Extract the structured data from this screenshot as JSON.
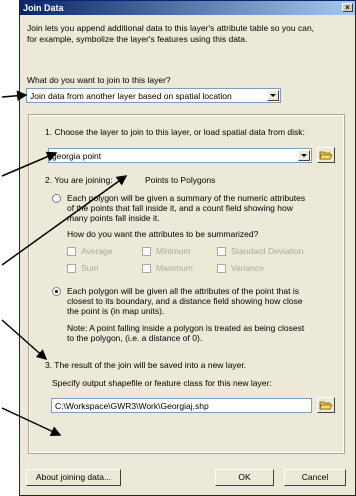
{
  "window": {
    "title": "Join Data",
    "close_glyph": "×"
  },
  "intro": {
    "line1": "Join lets you append additional data to this layer's attribute table so you can,",
    "line2": "for example, symbolize the layer's features using this data."
  },
  "join_type": {
    "question": "What do you want to join to this layer?",
    "selected": "Join data from another layer based on spatial location"
  },
  "step1": {
    "label": "1.  Choose the layer to join to this layer, or load spatial data from disk:",
    "layer": "georgia point"
  },
  "step2": {
    "label": "2.  You are joining:",
    "joining": "Points to Polygons",
    "option_summary": {
      "line1": "Each polygon will be given a summary of the numeric attributes",
      "line2": "of the points that fall inside it, and a count field showing how",
      "line3": "many points fall inside it.",
      "question": "How do you want the attributes to be summarized?",
      "checkboxes": [
        "Average",
        "Minimum",
        "Standard Deviation",
        "Sum",
        "Maximum",
        "Variance"
      ]
    },
    "option_closest": {
      "line1": "Each polygon will be given all the attributes of the point that is",
      "line2": "closest to its boundary, and a distance field showing how close",
      "line3": "the point is (in map units).",
      "note1": "Note: A point falling inside a polygon is treated as being closest",
      "note2": "to the polygon, (i.e. a distance of 0)."
    }
  },
  "step3": {
    "label": "3.  The result of the join will be saved into a new layer.",
    "specify": "Specify output shapefile or feature class for this new layer:",
    "output_path": "C:\\Workspace\\GWR3\\Work\\Georgiaj.shp"
  },
  "buttons": {
    "about": "About joining data...",
    "ok": "OK",
    "cancel": "Cancel"
  },
  "icons": {
    "folder": "open-folder-icon",
    "dropdown": "chevron-down-icon",
    "radio": "radio-button",
    "checkbox": "checkbox"
  }
}
